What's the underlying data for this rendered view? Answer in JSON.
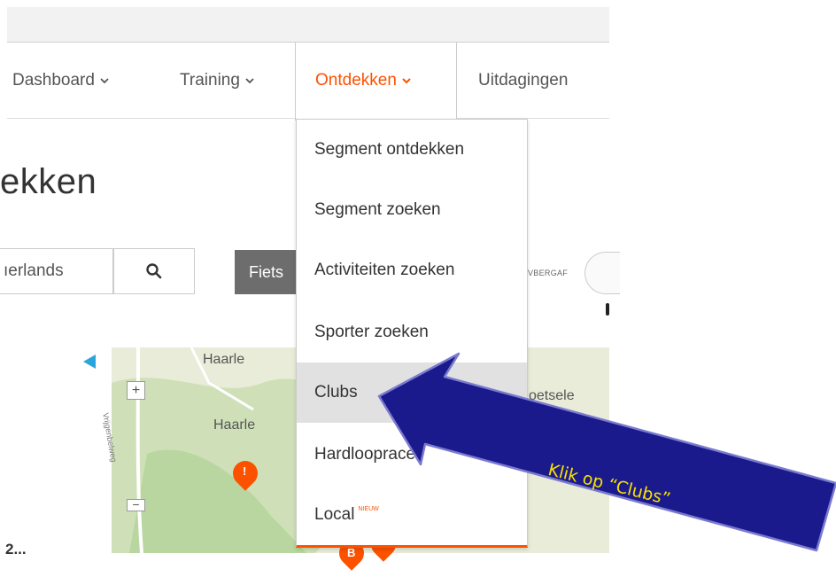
{
  "nav": {
    "items": [
      {
        "label": "Dashboard",
        "has_chevron": true
      },
      {
        "label": "Training",
        "has_chevron": true
      },
      {
        "label": "Ontdekken",
        "has_chevron": true,
        "active": true
      },
      {
        "label": "Uitdagingen",
        "has_chevron": false
      }
    ],
    "active_color": "#fc5200"
  },
  "page": {
    "title": "ekken"
  },
  "search": {
    "value": "ıerlands",
    "icon": "search-icon"
  },
  "filters": {
    "sport_button": "Fiets",
    "overlap_label": "VBERGAF"
  },
  "dropdown": {
    "items": [
      {
        "label": "Segment ontdekken"
      },
      {
        "label": "Segment zoeken"
      },
      {
        "label": "Activiteiten zoeken"
      },
      {
        "label": "Sporter zoeken"
      },
      {
        "label": "Clubs",
        "highlighted": true
      },
      {
        "label": "Hardloopraces"
      },
      {
        "label": "Local",
        "badge": "NIEUW"
      }
    ]
  },
  "map": {
    "labels": [
      "Haarle",
      "Haarle",
      "oetsele"
    ],
    "road": "Vrijgenbelweg",
    "markers": [
      "!",
      "B"
    ],
    "zoom_in": "+",
    "zoom_out": "−"
  },
  "list": {
    "row_number": "2..."
  },
  "annotation": {
    "text": "Klik op “Clubs”",
    "arrow_fill": "#1a1a8c",
    "text_color": "#f8e100"
  }
}
